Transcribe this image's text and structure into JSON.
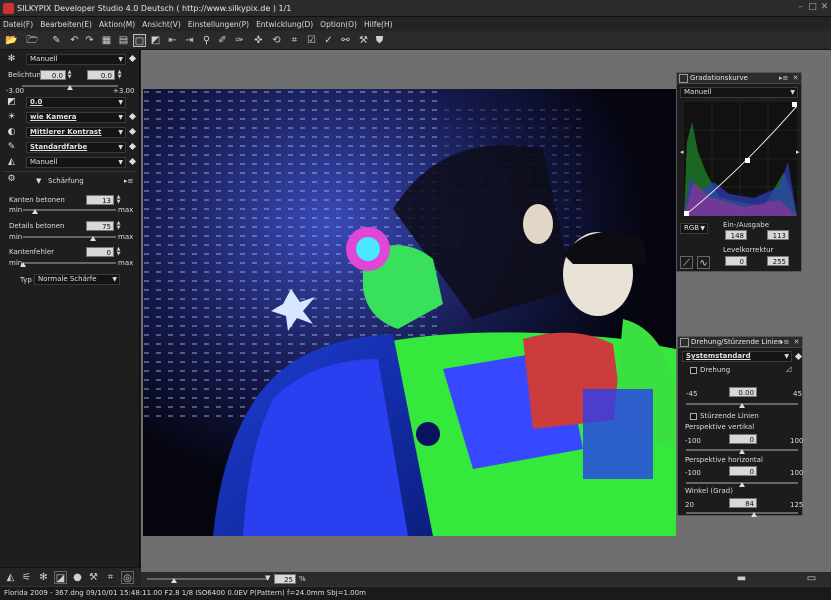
{
  "window": {
    "title": "SILKYPIX Developer Studio 4.0 Deutsch ( http://www.silkypix.de )  1/1"
  },
  "menu": [
    "Datei(F)",
    "Bearbeiten(E)",
    "Aktion(M)",
    "Ansicht(V)",
    "Einstellungen(P)",
    "Entwicklung(D)",
    "Option(O)",
    "Hilfe(H)"
  ],
  "left_panel": {
    "preset": "Manuell",
    "exposure": {
      "label": "Belichtung",
      "value1": "0.0",
      "value2": "0.0",
      "min": "-3.00",
      "max": "+3.00"
    },
    "wb": "0.0",
    "color": "wie Kamera",
    "contrast": "Mittlerer Kontrast",
    "colorstyle": "Standardfarbe",
    "sharpness_preset": "Manuell",
    "section_title": "Schärfung",
    "edge": {
      "label": "Kanten betonen",
      "value": "13",
      "min": "min",
      "max": "max",
      "pct": 0.13
    },
    "detail": {
      "label": "Details betonen",
      "value": "75",
      "min": "min",
      "max": "max",
      "pct": 0.75
    },
    "edgeerr": {
      "label": "Kantenfehler",
      "value": "0",
      "min": "min",
      "max": "max",
      "pct": 0.0
    },
    "type_label": "Typ",
    "type_value": "Normale Schärfe"
  },
  "tone_curve_panel": {
    "title": "Gradationskurve",
    "preset": "Manuell",
    "channel": "RGB",
    "io_label": "Ein-/Ausgabe",
    "io_in": "148",
    "io_out": "113",
    "level_label": "Levelkorrektur",
    "level_low": "0",
    "level_high": "255"
  },
  "rotation_panel": {
    "title": "Drehung/Stürzende Linien",
    "preset": "Systemstandard",
    "rotation_label": "Drehung",
    "rot_min": "-45",
    "rot_value": "0.00",
    "rot_max": "45",
    "persp_label": "Stürzende Linien",
    "vert_label": "Perspektive vertikal",
    "vert_min": "-100",
    "vert_value": "0",
    "vert_max": "100",
    "horiz_label": "Perspektive horizontal",
    "horiz_min": "-100",
    "horiz_value": "0",
    "horiz_max": "100",
    "angle_label": "Winkel (Grad)",
    "angle_min": "20",
    "angle_value": "84",
    "angle_max": "125"
  },
  "zoom": {
    "value": "25",
    "unit": "%"
  },
  "status": "Florida 2009 - 367.dng 09/10/01 15:48:11.00 F2.8 1/8 ISO6400   0.0EV P(Pattern) f=24.0mm Sbj=1.00m"
}
